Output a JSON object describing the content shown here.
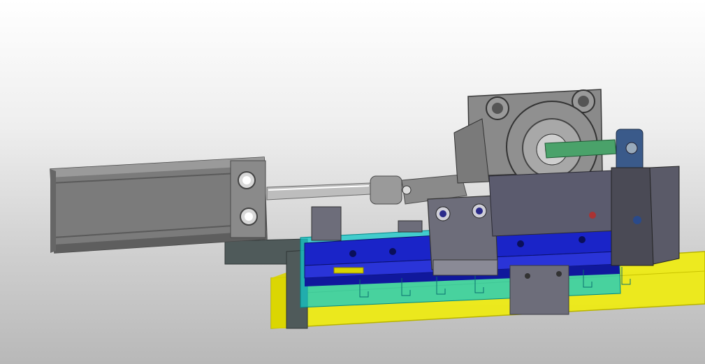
{
  "viewport": {
    "background_top": "#ffffff",
    "background_bottom": "#b8b8b8"
  },
  "model": {
    "colors": {
      "cylinder_body": "#7b7b7b",
      "cylinder_edge": "#4a4a4a",
      "rod": "#bdbdbd",
      "base_plate_yellow": "#f2ee00",
      "transparent_cyan": "#11c9c9",
      "slide_blue": "#1a24c8",
      "block_gray": "#5b5b6e",
      "bracket_gray": "#6d6d7a",
      "dark_plate": "#4f5a5a",
      "motor_gray": "#8a8a8a",
      "valve_blue": "#3a5a8a",
      "green_rod": "#4aa26a"
    },
    "parts": [
      "air-cylinder",
      "piston-rod",
      "rod-clevis",
      "linear-slide",
      "base-plate",
      "rotary-actuator",
      "valve-block",
      "support-bracket",
      "guide-block"
    ]
  }
}
